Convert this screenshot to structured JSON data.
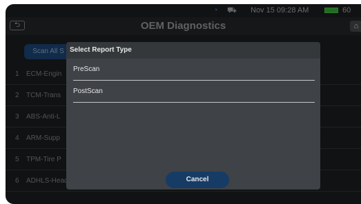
{
  "status_bar": {
    "datetime": "Nov 15  09:28 AM",
    "battery_text": "60",
    "wifi_icon": "wifi-icon",
    "car_icon": "car-icon",
    "battery_icon": "battery-icon"
  },
  "header": {
    "title": "OEM Diagnostics",
    "back_glyph": "⮌",
    "home_glyph": "⌂"
  },
  "toolbar": {
    "scan_all_label": "Scan All S"
  },
  "systems": [
    {
      "num": "1",
      "name": "ECM-Engin"
    },
    {
      "num": "2",
      "name": "TCM-Trans"
    },
    {
      "num": "3",
      "name": "ABS-Anti-L"
    },
    {
      "num": "4",
      "name": "ARM-Supp"
    },
    {
      "num": "5",
      "name": "TPM-Tire P"
    },
    {
      "num": "6",
      "name": "ADHLS-Headlamp Levelling System"
    }
  ],
  "dialog": {
    "title": "Select Report Type",
    "options": [
      {
        "label": "PreScan"
      },
      {
        "label": "PostScan"
      }
    ],
    "cancel_label": "Cancel"
  },
  "colors": {
    "background": "#17191b",
    "dialog": "#3f4246",
    "accent_button": "#163c66",
    "wifi": "#1e6fd1",
    "battery": "#2f8f2f"
  }
}
